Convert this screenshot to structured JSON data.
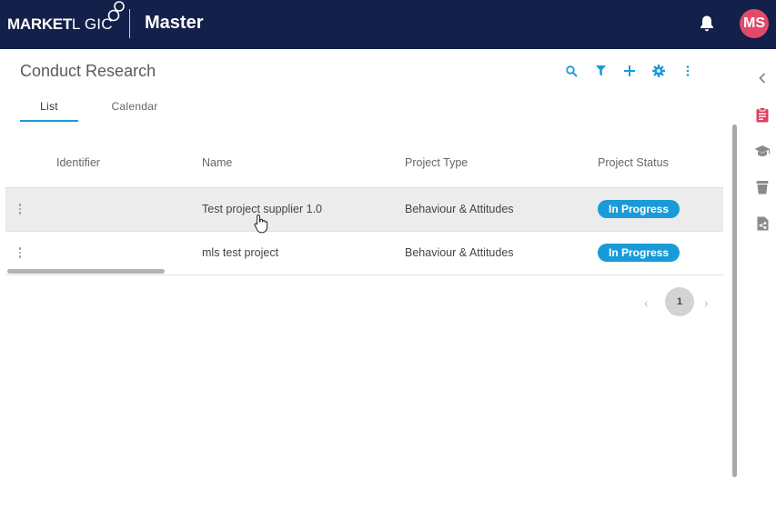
{
  "header": {
    "logo_market": "MARKET",
    "logo_logic": "L GIC",
    "app_name": "Master",
    "user_initials": "MS",
    "bell_icon": "bell-icon"
  },
  "page": {
    "title": "Conduct Research",
    "toolbar": [
      "search-icon",
      "filter-icon",
      "plus-icon",
      "gear-icon",
      "more-vertical-icon"
    ]
  },
  "tabs": [
    {
      "label": "List",
      "active": true
    },
    {
      "label": "Calendar",
      "active": false
    }
  ],
  "table": {
    "columns": [
      "Identifier",
      "Name",
      "Project Type",
      "Project Status"
    ],
    "rows": [
      {
        "identifier": "",
        "name": "Test project supplier 1.0",
        "type": "Behaviour & Attitudes",
        "status": "In Progress"
      },
      {
        "identifier": "",
        "name": "mls test project",
        "type": "Behaviour & Attitudes",
        "status": "In Progress"
      }
    ]
  },
  "pagination": {
    "current_page": "1",
    "prev": "‹",
    "next": "›"
  },
  "rail": [
    "chevron-left-icon",
    "clipboard-icon",
    "graduation-cap-icon",
    "cup-icon",
    "document-share-icon"
  ],
  "colors": {
    "topbar": "#13204a",
    "accent": "#1a9bd7",
    "avatar": "#e24a6b",
    "rail_active": "#e0405f"
  }
}
